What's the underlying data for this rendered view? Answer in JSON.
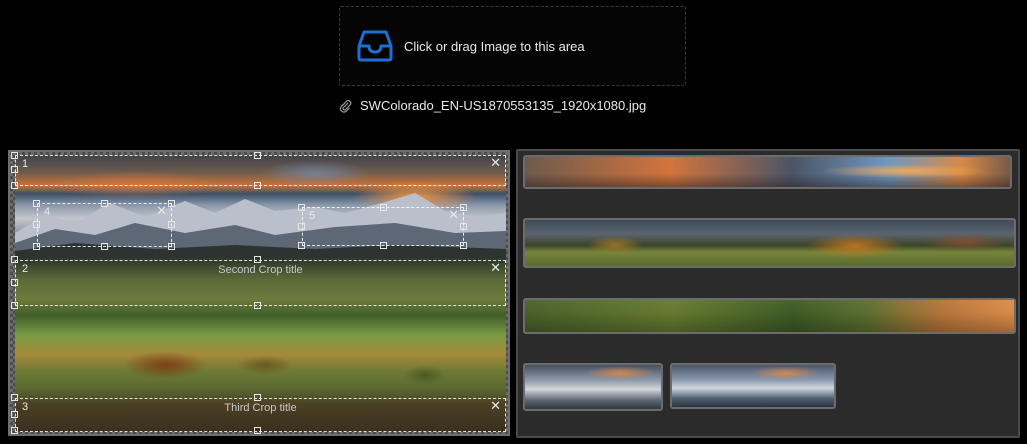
{
  "upload": {
    "prompt": "Click or drag Image to this area",
    "icon": "inbox-icon",
    "accent": "#1e6fcf"
  },
  "file": {
    "name": "SWColorado_EN-US1870553135_1920x1080.jpg",
    "icon": "paperclip-icon"
  },
  "crops": [
    {
      "number": "1",
      "title": ""
    },
    {
      "number": "2",
      "title": "Second Crop title"
    },
    {
      "number": "3",
      "title": "Third Crop title"
    },
    {
      "number": "4",
      "title": ""
    },
    {
      "number": "5",
      "title": ""
    }
  ],
  "close_glyph": "✕"
}
